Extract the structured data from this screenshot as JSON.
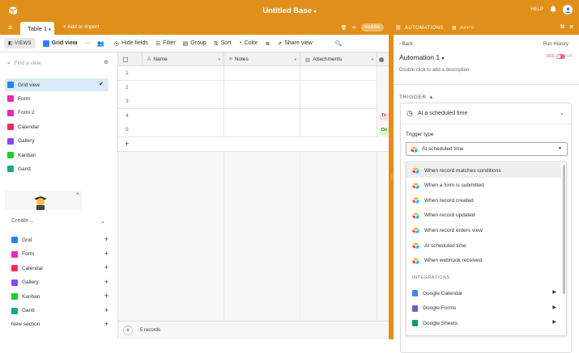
{
  "topbar": {
    "title": "Untitled Base",
    "help": "HELP"
  },
  "tabs": {
    "active": "Table 1",
    "add_import": "Add or import",
    "share": "SHARE",
    "automations": "AUTOMATIONS",
    "apps": "APPS"
  },
  "toolbar": {
    "views": "VIEWS",
    "current_view": "Grid view",
    "hide_fields": "Hide fields",
    "filter": "Filter",
    "group": "Group",
    "sort": "Sort",
    "color": "Color",
    "share_view": "Share view"
  },
  "sidebar": {
    "find_placeholder": "Find a view",
    "views": [
      {
        "label": "Grid view",
        "color": "#2d7ff9"
      },
      {
        "label": "Form",
        "color": "#e929ba"
      },
      {
        "label": "Form 2",
        "color": "#e929ba"
      },
      {
        "label": "Calendar",
        "color": "#f82b60"
      },
      {
        "label": "Gallery",
        "color": "#8b46ff"
      },
      {
        "label": "Kanban",
        "color": "#20c933"
      },
      {
        "label": "Gantt",
        "color": "#1aa78c"
      }
    ],
    "create_label": "Create...",
    "create_items": [
      {
        "label": "Grid",
        "color": "#2d7ff9"
      },
      {
        "label": "Form",
        "color": "#e929ba"
      },
      {
        "label": "Calendar",
        "color": "#f82b60"
      },
      {
        "label": "Gallery",
        "color": "#8b46ff"
      },
      {
        "label": "Kanban",
        "color": "#20c933"
      },
      {
        "label": "Gantt",
        "color": "#1aa78c"
      }
    ],
    "new_section": "New section"
  },
  "grid": {
    "columns": [
      "Name",
      "Notes",
      "Attachments"
    ],
    "rows": [
      "1",
      "2",
      "3",
      "4",
      "5"
    ],
    "chips": [
      {
        "text": "To",
        "bg": "#ffdce5"
      },
      {
        "text": "Do",
        "bg": "#d1f7c4"
      }
    ],
    "add_row": "+",
    "record_count": "5 records"
  },
  "automation": {
    "back": "Back",
    "run_history": "Run History",
    "name": "Automation 1",
    "toggle_off": "OFF",
    "toggle_on": "ON",
    "description_hint": "Double click to add a description",
    "trigger_section": "TRIGGER",
    "trigger_title": "At a scheduled time",
    "trigger_type_label": "Trigger type",
    "trigger_type_value": "At scheduled time",
    "options": [
      "When record matches conditions",
      "When a form is submitted",
      "When record created",
      "When record updated",
      "When record enters view",
      "At scheduled time",
      "When webhook received"
    ],
    "integrations_label": "INTEGRATIONS",
    "integrations": [
      {
        "label": "Google Calendar",
        "color": "#4285f4"
      },
      {
        "label": "Google Forms",
        "color": "#7e57c2"
      },
      {
        "label": "Google Sheets",
        "color": "#0f9d58"
      }
    ]
  }
}
